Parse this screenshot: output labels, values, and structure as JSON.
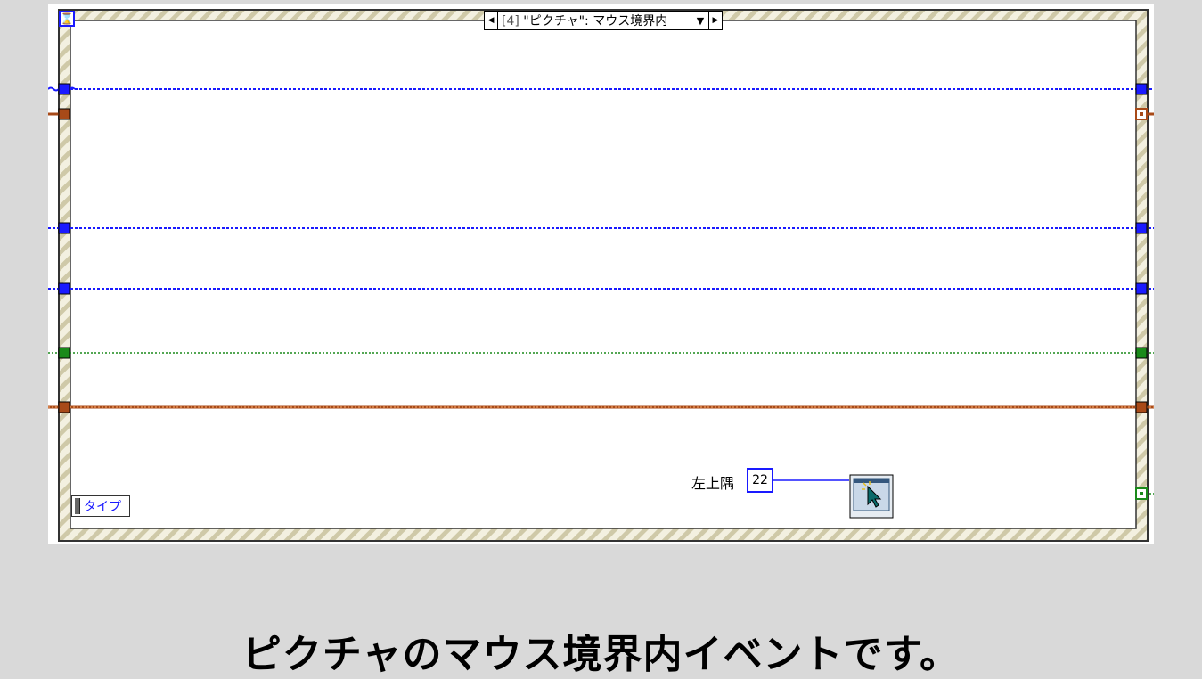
{
  "event_structure": {
    "case_selector": {
      "index": "[4]",
      "label": "\"ピクチャ\": マウス境界内",
      "prev_arrow": "◀",
      "next_arrow": "▶",
      "dropdown_arrow": "▼"
    },
    "timeout_icon": "hourglass-icon",
    "type_node_label": "タイプ"
  },
  "constant": {
    "label": "左上隅",
    "value": "22"
  },
  "cursor_vi_icon": "mouse-cursor-icon",
  "wire_colors": {
    "blue": "#1a1aff",
    "orange": "#a84a18",
    "green": "#1a8a1a",
    "frame_stripe": "#cfc9a8"
  },
  "caption": "ピクチャのマウス境界内イベントです。"
}
